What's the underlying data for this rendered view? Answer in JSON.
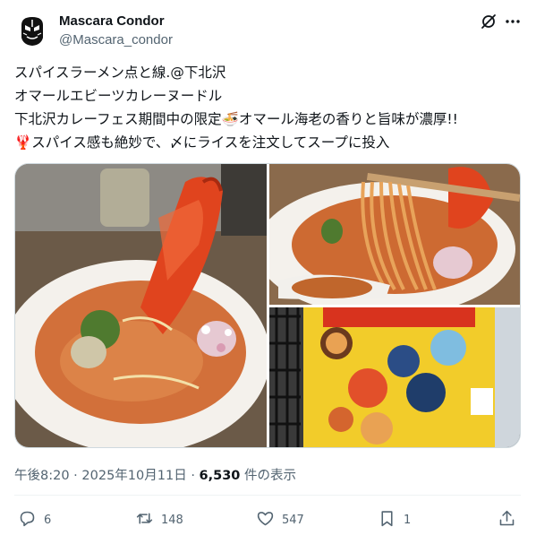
{
  "author": {
    "name": "Mascara Condor",
    "handle": "@Mascara_condor"
  },
  "tweet": {
    "lines": [
      "スパイスラーメン点と線.@下北沢",
      "オマールエビーツカレーヌードル",
      "下北沢カレーフェス期間中の限定🍜オマール海老の香りと旨味が濃厚!!",
      "🦞スパイス感も絶妙で、〆にライスを注文してスープに投入"
    ]
  },
  "meta": {
    "time": "午後8:20",
    "separator": "·",
    "date": "2025年10月11日",
    "views_count": "6,530",
    "views_label": "件の表示"
  },
  "actions": {
    "replies": "6",
    "reposts": "148",
    "likes": "547",
    "bookmarks": "1"
  },
  "icons": {
    "header": [
      "grok-slash-icon",
      "more-options-icon"
    ],
    "actions": [
      "reply-icon",
      "repost-icon",
      "like-icon",
      "bookmark-icon",
      "share-icon"
    ]
  },
  "colors": {
    "text": "#0f1419",
    "secondary": "#536471",
    "border": "#cfd9de"
  }
}
